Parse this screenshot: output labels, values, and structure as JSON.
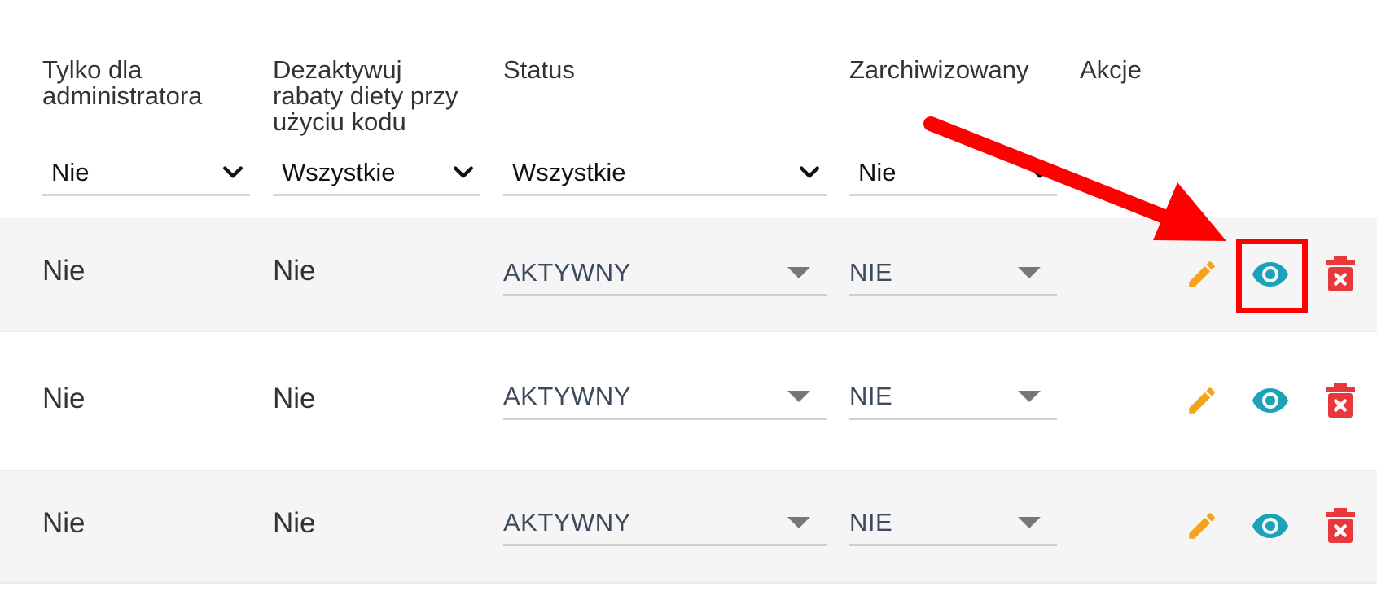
{
  "columns": {
    "admin_only": "Tylko dla\nadministratora",
    "deactivate": "Dezaktywuj\nrabaty diety przy\nużyciu kodu",
    "status": "Status",
    "archived": "Zarchiwizowany",
    "actions": "Akcje"
  },
  "filters": {
    "admin_only": "Nie",
    "deactivate": "Wszystkie",
    "status": "Wszystkie",
    "archived": "Nie"
  },
  "rows": [
    {
      "admin_only": "Nie",
      "deactivate": "Nie",
      "status": "AKTYWNY",
      "archived": "NIE"
    },
    {
      "admin_only": "Nie",
      "deactivate": "Nie",
      "status": "AKTYWNY",
      "archived": "NIE"
    },
    {
      "admin_only": "Nie",
      "deactivate": "Nie",
      "status": "AKTYWNY",
      "archived": "NIE"
    }
  ],
  "icons": {
    "edit": "pencil-icon",
    "view": "eye-icon",
    "delete": "trash-icon",
    "filter_dropdown": "chevron-down-icon",
    "select_dropdown": "caret-down-icon"
  },
  "colors": {
    "edit": "#f5a31a",
    "view": "#1aa3b8",
    "delete": "#e8383c",
    "highlight": "#ff0000",
    "row_shade": "#f5f5f5"
  }
}
